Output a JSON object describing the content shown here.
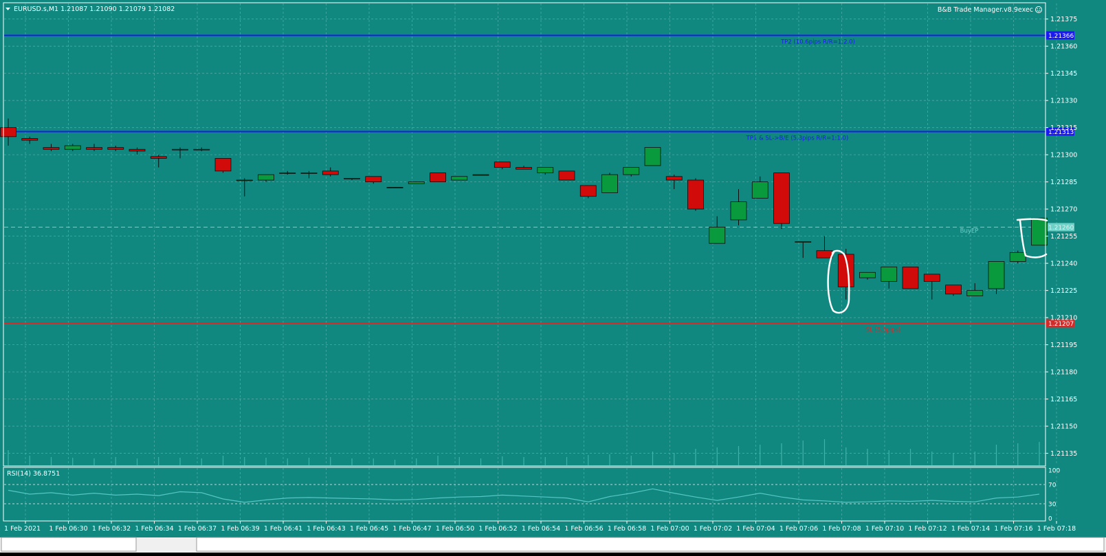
{
  "colors": {
    "chart_bg": "#108880",
    "grid": "#7fc9c1",
    "frame": "#ffffff",
    "axis_text": "#ffffff",
    "bull": "#0a9a3e",
    "bear": "#d10a0a",
    "wick": "#0b0b0b",
    "tp_line": "#1a1aee",
    "sl_line": "#d42a2a",
    "entry_line": "#6fd0c8",
    "rsi_line": "#56c6c3",
    "annotation": "#ffffff"
  },
  "header": {
    "symbol_info": "EURUSD.s,M1  1.21087 1.21090 1.21079 1.21082",
    "ea_label": "B&B Trade Manager.v8.9exec",
    "ea_icon": "smiley-icon",
    "menu_icon": "triangle-down-icon"
  },
  "price_levels": [
    {
      "price": 1.21366,
      "label": "1.21366",
      "text": "TP2 (10.6pips R/R=1:2.0)",
      "color": "#1a1aee"
    },
    {
      "price": 1.21313,
      "label": "1.21313",
      "text": "TP1 & SL->B/E (5.3pips R/R=1:1.0)",
      "color": "#1a1aee"
    },
    {
      "price": 1.2126,
      "label": "1.21260",
      "text": "BuyEP",
      "color": "#6fd0c8"
    },
    {
      "price": 1.21207,
      "label": "1.21207",
      "text": "SL (5.3pips)",
      "color": "#d42a2a"
    }
  ],
  "subwindow": {
    "label": "RSI(14) 36.8751",
    "levels": [
      "100",
      "70",
      "30",
      "0"
    ]
  },
  "chart_data": {
    "type": "candlestick",
    "symbol": "EURUSD.s",
    "timeframe": "M1",
    "ylim": [
      1.21128,
      1.21384
    ],
    "y_ticks": [
      1.21375,
      1.2136,
      1.21345,
      1.2133,
      1.21315,
      1.213,
      1.21285,
      1.2127,
      1.21255,
      1.2124,
      1.21225,
      1.2121,
      1.21195,
      1.2118,
      1.21165,
      1.2115,
      1.21135
    ],
    "y_tick_labels": [
      "1.21375",
      "1.21360",
      "1.21345",
      "1.21330",
      "1.21315",
      "1.21300",
      "1.21285",
      "1.21270",
      "1.21255",
      "1.21240",
      "1.21225",
      "1.21210",
      "1.21195",
      "1.21180",
      "1.21165",
      "1.21150",
      "1.21135"
    ],
    "x_labels": [
      "1 Feb 2021",
      "1 Feb 06:30",
      "1 Feb 06:32",
      "1 Feb 06:34",
      "1 Feb 06:37",
      "1 Feb 06:39",
      "1 Feb 06:41",
      "1 Feb 06:43",
      "1 Feb 06:45",
      "1 Feb 06:47",
      "1 Feb 06:50",
      "1 Feb 06:52",
      "1 Feb 06:54",
      "1 Feb 06:56",
      "1 Feb 06:58",
      "1 Feb 07:00",
      "1 Feb 07:02",
      "1 Feb 07:04",
      "1 Feb 07:06",
      "1 Feb 07:08",
      "1 Feb 07:10",
      "1 Feb 07:12",
      "1 Feb 07:14",
      "1 Feb 07:16",
      "1 Feb 07:18"
    ],
    "candles": [
      [
        1.21315,
        1.2132,
        1.21305,
        1.2131
      ],
      [
        1.21309,
        1.2131,
        1.21306,
        1.21308
      ],
      [
        1.21304,
        1.21306,
        1.21302,
        1.21303
      ],
      [
        1.21303,
        1.21306,
        1.21302,
        1.21305
      ],
      [
        1.21304,
        1.21306,
        1.21302,
        1.21303
      ],
      [
        1.21304,
        1.21305,
        1.21302,
        1.21303
      ],
      [
        1.21303,
        1.21304,
        1.213,
        1.21302
      ],
      [
        1.21299,
        1.213,
        1.21293,
        1.21298
      ],
      [
        1.21303,
        1.21304,
        1.21298,
        1.21303
      ],
      [
        1.21303,
        1.21304,
        1.21302,
        1.21303
      ],
      [
        1.21298,
        1.21298,
        1.2129,
        1.21291
      ],
      [
        1.21286,
        1.21287,
        1.21277,
        1.21286
      ],
      [
        1.21286,
        1.21289,
        1.21285,
        1.21289
      ],
      [
        1.2129,
        1.21291,
        1.21289,
        1.2129
      ],
      [
        1.2129,
        1.21291,
        1.21287,
        1.2129
      ],
      [
        1.21291,
        1.21293,
        1.21288,
        1.21289
      ],
      [
        1.21287,
        1.21287,
        1.21286,
        1.21287
      ],
      [
        1.21288,
        1.21288,
        1.21284,
        1.21285
      ],
      [
        1.21282,
        1.21282,
        1.21282,
        1.21282
      ],
      [
        1.21284,
        1.21285,
        1.21284,
        1.21285
      ],
      [
        1.2129,
        1.2129,
        1.21285,
        1.21285
      ],
      [
        1.21286,
        1.21288,
        1.21286,
        1.21288
      ],
      [
        1.21289,
        1.21289,
        1.21289,
        1.21289
      ],
      [
        1.21296,
        1.21296,
        1.21292,
        1.21293
      ],
      [
        1.21293,
        1.21294,
        1.21292,
        1.21292
      ],
      [
        1.2129,
        1.21293,
        1.21289,
        1.21293
      ],
      [
        1.21291,
        1.21291,
        1.21286,
        1.21286
      ],
      [
        1.21283,
        1.21283,
        1.21276,
        1.21277
      ],
      [
        1.21279,
        1.2129,
        1.21279,
        1.21289
      ],
      [
        1.21289,
        1.21293,
        1.21288,
        1.21293
      ],
      [
        1.21294,
        1.21304,
        1.21294,
        1.21304
      ],
      [
        1.21288,
        1.21289,
        1.21281,
        1.21286
      ],
      [
        1.21286,
        1.21287,
        1.21269,
        1.2127
      ],
      [
        1.21251,
        1.21266,
        1.21251,
        1.2126
      ],
      [
        1.21264,
        1.21281,
        1.21261,
        1.21274
      ],
      [
        1.21276,
        1.21288,
        1.21276,
        1.21285
      ],
      [
        1.2129,
        1.2129,
        1.21259,
        1.21262
      ],
      [
        1.21252,
        1.21252,
        1.21243,
        1.21252
      ],
      [
        1.21247,
        1.21255,
        1.21243,
        1.21243
      ],
      [
        1.21245,
        1.21248,
        1.2122,
        1.21227
      ],
      [
        1.21232,
        1.21235,
        1.21231,
        1.21235
      ],
      [
        1.2123,
        1.21238,
        1.21226,
        1.21238
      ],
      [
        1.21238,
        1.21238,
        1.21226,
        1.21226
      ],
      [
        1.21234,
        1.21234,
        1.2122,
        1.2123
      ],
      [
        1.21228,
        1.21228,
        1.21222,
        1.21223
      ],
      [
        1.21222,
        1.21229,
        1.21222,
        1.21225
      ],
      [
        1.21226,
        1.21241,
        1.21223,
        1.21241
      ],
      [
        1.21241,
        1.21247,
        1.2124,
        1.21246
      ],
      [
        1.2125,
        1.21265,
        1.2125,
        1.21265
      ]
    ],
    "rsi": [
      58,
      50,
      53,
      48,
      52,
      48,
      50,
      47,
      55,
      53,
      40,
      33,
      38,
      42,
      43,
      42,
      41,
      40,
      38,
      39,
      42,
      44,
      45,
      48,
      46,
      44,
      42,
      34,
      45,
      52,
      61,
      52,
      44,
      37,
      44,
      52,
      44,
      38,
      36,
      33,
      34,
      36,
      35,
      37,
      35,
      34,
      42,
      44,
      50
    ],
    "volumes": [
      22,
      14,
      12,
      11,
      10,
      12,
      10,
      12,
      11,
      10,
      14,
      12,
      11,
      10,
      11,
      12,
      10,
      10,
      8,
      10,
      14,
      12,
      10,
      13,
      12,
      12,
      12,
      15,
      16,
      14,
      20,
      18,
      24,
      26,
      28,
      30,
      32,
      36,
      38,
      26,
      24,
      22,
      24,
      20,
      18,
      20,
      30,
      32,
      34
    ],
    "grid": true
  }
}
